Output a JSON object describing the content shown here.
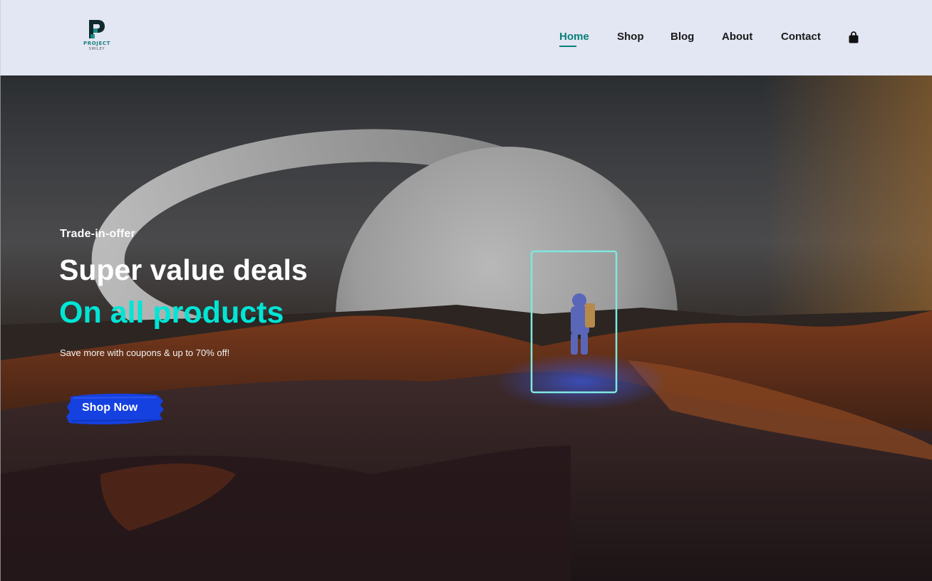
{
  "brand": {
    "name": "PROJECT",
    "sub": "SMILEY",
    "accent_color": "#088178"
  },
  "nav": {
    "items": [
      {
        "label": "Home",
        "active": true
      },
      {
        "label": "Shop",
        "active": false
      },
      {
        "label": "Blog",
        "active": false
      },
      {
        "label": "About",
        "active": false
      },
      {
        "label": "Contact",
        "active": false
      }
    ],
    "cart_icon": "shopping-bag-icon"
  },
  "hero": {
    "eyebrow": "Trade-in-offer",
    "headline": "Super value deals",
    "headline_accent": "On all products",
    "headline_accent_color": "#00e5d6",
    "subtext": "Save more with coupons & up to 70% off!",
    "cta_label": "Shop Now",
    "cta_color": "#1541e0"
  }
}
